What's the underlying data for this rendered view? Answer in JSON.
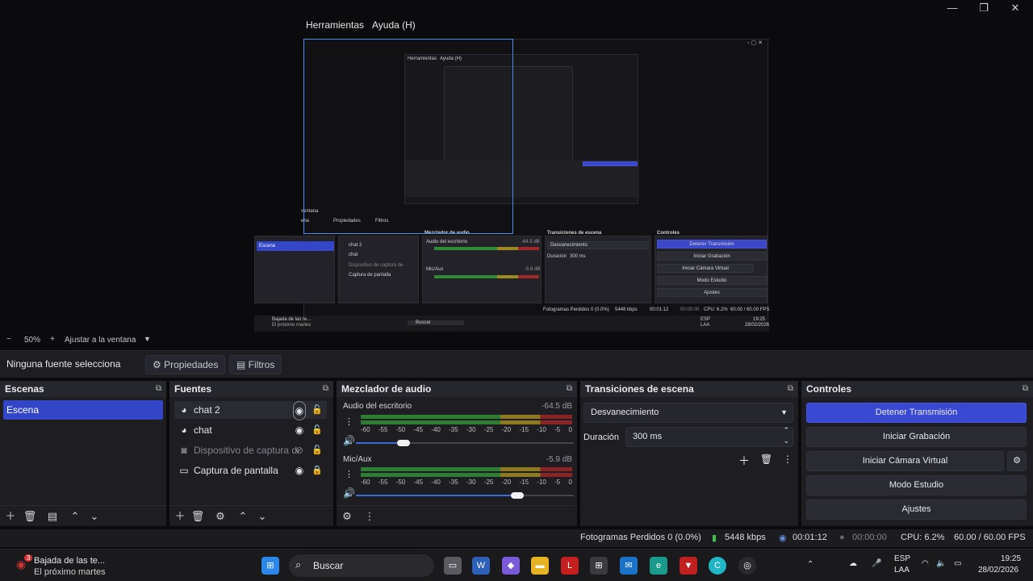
{
  "window": {
    "minimize": "—",
    "maximize": "❐",
    "close": "✕"
  },
  "menubar": {
    "items": [
      "Herramientas",
      "Ayuda (H)"
    ]
  },
  "preview_nested": {
    "menu1": "Herramientas",
    "menu2": "Ayuda (H)",
    "panels": {
      "scenes_item": "Escena",
      "sources": [
        "chat 2",
        "chat",
        "Dispositivo de captura de",
        "Captura de pantalla"
      ],
      "mixer_title": "Mezclador de audio",
      "mixer_audio1": "Audio del escritorio",
      "mixer_audio1_db": "-64.5 dB",
      "mixer_audio2": "Mic/Aux",
      "mixer_audio2_db": "-5.9 dB",
      "transitions_title": "Transiciones de escena",
      "transition_value": "Desvanecimiento",
      "duration_label": "Duración",
      "duration_value": "300 ms",
      "controls_title": "Controles",
      "controls": [
        "Detener Transmisión",
        "Iniciar Grabación",
        "Iniciar Cámara Virtual",
        "Modo Estudio",
        "Ajustes"
      ],
      "props": "Propiedades",
      "filters": "Filtros",
      "ventana": "ventana",
      "ena": "ena",
      "status": [
        "Fotogramas Perdidos 0 (0.0%)",
        "5448 kbps",
        "00:01:12",
        "00:00:00",
        "CPU: 6.2%",
        "60.00 / 60.00 FPS"
      ],
      "taskbar_notif_title": "Bajada de las te...",
      "taskbar_notif_sub": "El próximo martes",
      "search": "Buscar",
      "lang1": "ESP",
      "lang2": "LAA",
      "time": "19:25",
      "date": "28/02/2026"
    }
  },
  "zoombar": {
    "minus": "−",
    "zoom": "50%",
    "plus": "+",
    "fit": "Ajustar a la ventana"
  },
  "context": {
    "no_source": "Ninguna fuente selecciona",
    "properties": "Propiedades",
    "filters": "Filtros"
  },
  "scenes": {
    "title": "Escenas",
    "items": [
      "Escena"
    ]
  },
  "sources": {
    "title": "Fuentes",
    "items": [
      {
        "label": "chat 2",
        "icon": "browser-icon",
        "visible": true,
        "locked": false
      },
      {
        "label": "chat",
        "icon": "browser-icon",
        "visible": true,
        "locked": false
      },
      {
        "label": "Dispositivo de captura de",
        "icon": "camera-icon",
        "visible": false,
        "locked": false
      },
      {
        "label": "Captura de pantalla",
        "icon": "monitor-icon",
        "visible": true,
        "locked": true
      }
    ]
  },
  "mixer": {
    "title": "Mezclador de audio",
    "channels": [
      {
        "name": "Audio del escritorio",
        "db": "-64.5 dB",
        "volume_fraction": 0.22
      },
      {
        "name": "Mic/Aux",
        "db": "-5.9 dB",
        "volume_fraction": 0.74
      }
    ],
    "ticks": [
      "-60",
      "-55",
      "-50",
      "-45",
      "-40",
      "-35",
      "-30",
      "-25",
      "-20",
      "-15",
      "-10",
      "-5",
      "0"
    ]
  },
  "transitions": {
    "title": "Transiciones de escena",
    "selected": "Desvanecimiento",
    "duration_label": "Duración",
    "duration_value": "300 ms"
  },
  "controls": {
    "title": "Controles",
    "stop_stream": "Detener Transmisión",
    "start_recording": "Iniciar Grabación",
    "start_virtual_cam": "Iniciar Cámara Virtual",
    "studio_mode": "Modo Estudio",
    "settings": "Ajustes"
  },
  "status": {
    "dropped_frames": "Fotogramas Perdidos 0 (0.0%)",
    "bitrate": "5448 kbps",
    "stream_time": "00:01:12",
    "record_time": "00:00:00",
    "cpu": "CPU: 6.2%",
    "fps": "60.00 / 60.00 FPS"
  },
  "taskbar": {
    "notification_title": "Bajada de las te...",
    "notification_sub": "El próximo martes",
    "notification_badge": "3",
    "search": "Buscar",
    "lang_top": "ESP",
    "lang_bottom": "LAA",
    "time": "19:25",
    "date": "28/02/2026"
  },
  "colors": {
    "accent": "#3a49d2",
    "panel": "#1d1d22",
    "header": "#26262d",
    "preview_select": "#4a8eea"
  }
}
